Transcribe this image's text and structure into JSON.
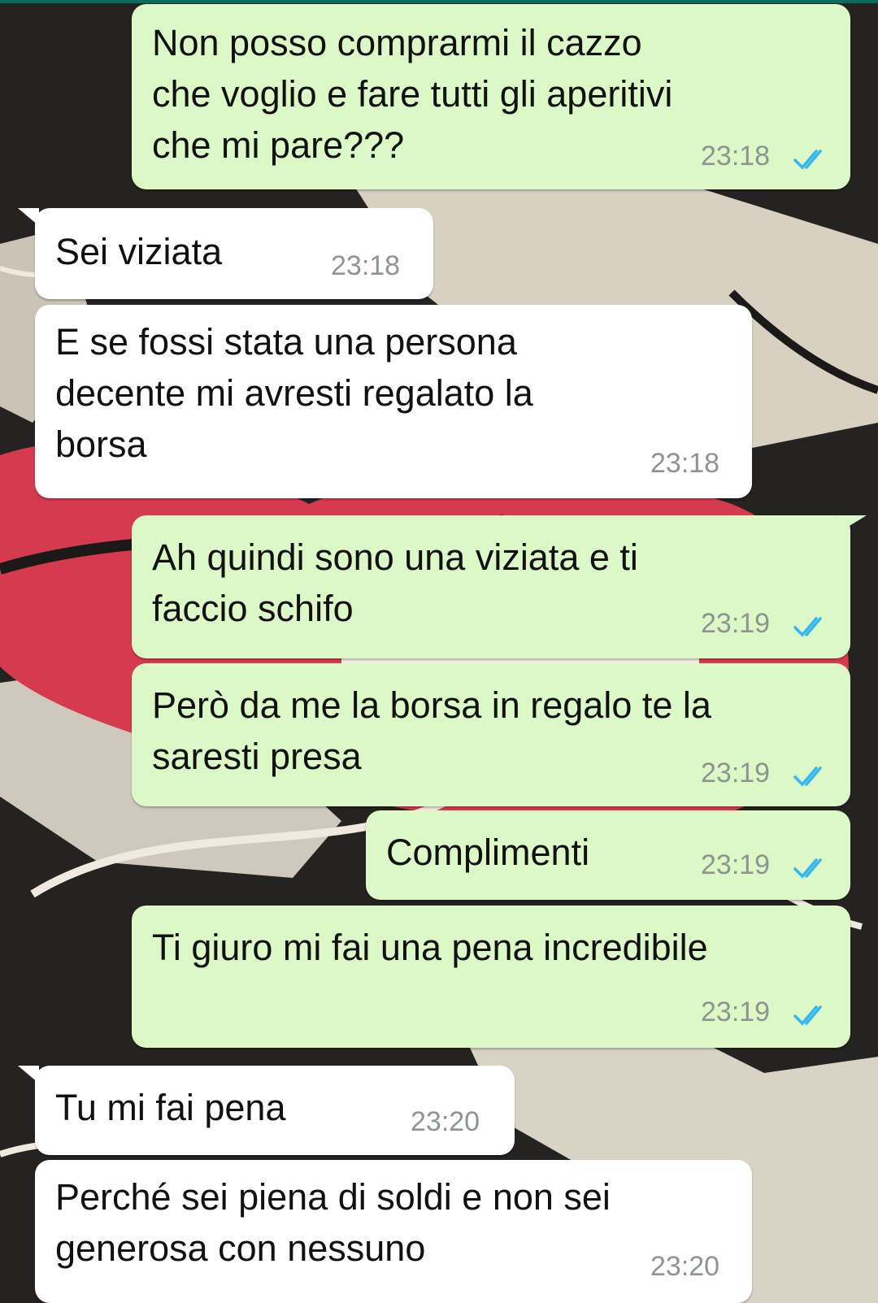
{
  "chat": {
    "messages": [
      {
        "direction": "out",
        "text": "Non posso comprarmi il cazzo\nche voglio e fare tutti gli aperitivi\nche mi pare???",
        "time": "23:18",
        "status": "read"
      },
      {
        "direction": "in",
        "text": "Sei viziata",
        "time": "23:18"
      },
      {
        "direction": "in",
        "text": "E se fossi stata una persona\ndecente mi avresti regalato la\nborsa",
        "time": "23:18"
      },
      {
        "direction": "out",
        "text": "Ah quindi sono una viziata e ti\nfaccio schifo",
        "time": "23:19",
        "status": "read"
      },
      {
        "direction": "out",
        "text": "Però da me la borsa in regalo te la\nsaresti presa",
        "time": "23:19",
        "status": "read"
      },
      {
        "direction": "out",
        "text": "Complimenti",
        "time": "23:19",
        "status": "read"
      },
      {
        "direction": "out",
        "text": "Ti giuro mi fai una pena incredibile",
        "time": "23:19",
        "status": "read"
      },
      {
        "direction": "in",
        "text": "Tu mi fai pena",
        "time": "23:20"
      },
      {
        "direction": "in",
        "text": "Perché sei piena di soldi e non sei\ngenerosa con nessuno",
        "time": "23:20"
      }
    ]
  },
  "colors": {
    "outgoing_bubble": "#dcf8c6",
    "incoming_bubble": "#ffffff",
    "read_ticks": "#34b7f1",
    "timestamp": "#8e9490"
  },
  "icons": {
    "read_receipt": "double-check-icon"
  }
}
